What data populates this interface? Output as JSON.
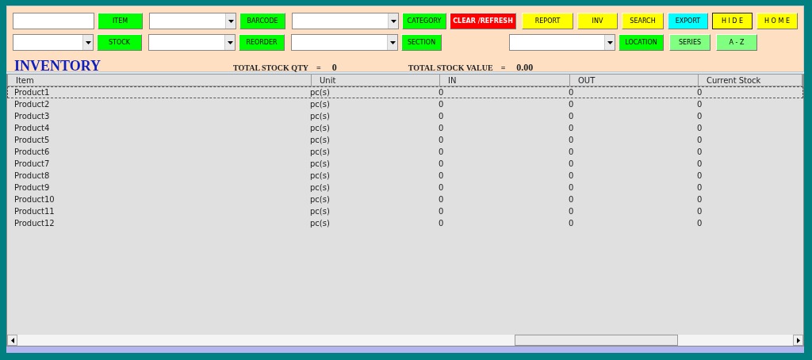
{
  "toolbar": [
    [
      {
        "kind": "textbox"
      },
      {
        "kind": "button",
        "label": "ITEM",
        "color": "#00ff00"
      },
      {
        "kind": "combo"
      },
      {
        "kind": "button",
        "label": "BARCODE",
        "color": "#00ff00"
      },
      {
        "kind": "combo"
      },
      {
        "kind": "button",
        "label": "CATEGORY",
        "color": "#00ff00"
      },
      {
        "kind": "button",
        "label": "CLEAR /REFRESH",
        "color": "#ff0000"
      },
      {
        "kind": "button",
        "label": "REPORT",
        "color": "#ffff00"
      },
      {
        "kind": "button",
        "label": "INV",
        "color": "#ffff00"
      },
      {
        "kind": "button",
        "label": "SEARCH",
        "color": "#ffff00"
      },
      {
        "kind": "button",
        "label": "EXPORT",
        "color": "#00ffff"
      },
      {
        "kind": "button",
        "label": "H I D E",
        "color": "#ffff00",
        "default": true
      },
      {
        "kind": "button",
        "label": "H O M E",
        "color": "#ffff00"
      }
    ],
    [
      {
        "kind": "combo"
      },
      {
        "kind": "button",
        "label": "STOCK",
        "color": "#00ff00"
      },
      {
        "kind": "combo"
      },
      {
        "kind": "button",
        "label": "REORDER",
        "color": "#00ff00"
      },
      {
        "kind": "combo"
      },
      {
        "kind": "button",
        "label": "SECTION",
        "color": "#00ff00"
      },
      {
        "kind": "combo"
      },
      {
        "kind": "button",
        "label": "LOCATION",
        "color": "#00ff00"
      },
      {
        "kind": "button",
        "label": "SERIES",
        "color": "#80ff80"
      },
      {
        "kind": "button",
        "label": "A - Z",
        "color": "#80ff80"
      }
    ]
  ],
  "title": "INVENTORY",
  "totals": [
    {
      "label": "TOTAL STOCK QTY",
      "sign": "=",
      "value": "0"
    },
    {
      "label": "TOTAL STOCK VALUE",
      "sign": "=",
      "value": "0.00"
    }
  ],
  "table": {
    "columns": [
      "Item",
      "Unit",
      "IN",
      "OUT",
      "Current Stock"
    ],
    "rows": [
      {
        "cells": [
          "Product1",
          "pc(s)",
          "0",
          "0",
          "0"
        ],
        "selected": true
      },
      {
        "cells": [
          "Product2",
          "pc(s)",
          "0",
          "0",
          "0"
        ],
        "selected": false
      },
      {
        "cells": [
          "Product3",
          "pc(s)",
          "0",
          "0",
          "0"
        ],
        "selected": false
      },
      {
        "cells": [
          "Product4",
          "pc(s)",
          "0",
          "0",
          "0"
        ],
        "selected": false
      },
      {
        "cells": [
          "Product5",
          "pc(s)",
          "0",
          "0",
          "0"
        ],
        "selected": false
      },
      {
        "cells": [
          "Product6",
          "pc(s)",
          "0",
          "0",
          "0"
        ],
        "selected": false
      },
      {
        "cells": [
          "Product7",
          "pc(s)",
          "0",
          "0",
          "0"
        ],
        "selected": false
      },
      {
        "cells": [
          "Product8",
          "pc(s)",
          "0",
          "0",
          "0"
        ],
        "selected": false
      },
      {
        "cells": [
          "Product9",
          "pc(s)",
          "0",
          "0",
          "0"
        ],
        "selected": false
      },
      {
        "cells": [
          "Product10",
          "pc(s)",
          "0",
          "0",
          "0"
        ],
        "selected": false
      },
      {
        "cells": [
          "Product11",
          "pc(s)",
          "0",
          "0",
          "0"
        ],
        "selected": false
      },
      {
        "cells": [
          "Product12",
          "pc(s)",
          "0",
          "0",
          "0"
        ],
        "selected": false
      }
    ]
  }
}
